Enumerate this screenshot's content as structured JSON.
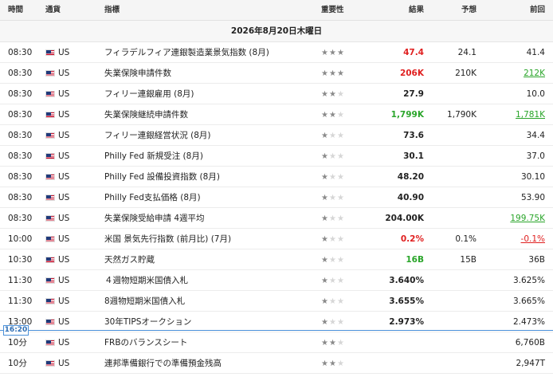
{
  "header": {
    "time": "時間",
    "currency": "通貨",
    "indicator": "指標",
    "importance": "重要性",
    "actual": "結果",
    "forecast": "予想",
    "previous": "前回"
  },
  "date_label": "2026年8月20日木曜日",
  "now_label": "16:20",
  "colors": {
    "negative": "#e02020",
    "positive": "#2aa52a",
    "now_line": "#4a90d9"
  },
  "rows": [
    {
      "time": "08:30",
      "currency": "US",
      "name": "フィラデルフィア連銀製造業景気指数 (8月)",
      "importance": 3,
      "actual": "47.4",
      "actual_color": "red",
      "forecast": "24.1",
      "previous": "41.4",
      "previous_style": ""
    },
    {
      "time": "08:30",
      "currency": "US",
      "name": "失業保険申請件数",
      "importance": 3,
      "actual": "206K",
      "actual_color": "red",
      "forecast": "210K",
      "previous": "212K",
      "previous_style": "link-green"
    },
    {
      "time": "08:30",
      "currency": "US",
      "name": "フィリー連銀雇用 (8月)",
      "importance": 2,
      "actual": "27.9",
      "actual_color": "",
      "forecast": "",
      "previous": "10.0",
      "previous_style": ""
    },
    {
      "time": "08:30",
      "currency": "US",
      "name": "失業保険継続申請件数",
      "importance": 2,
      "actual": "1,799K",
      "actual_color": "green",
      "forecast": "1,790K",
      "previous": "1,781K",
      "previous_style": "link-green"
    },
    {
      "time": "08:30",
      "currency": "US",
      "name": "フィリー連銀経営状況 (8月)",
      "importance": 1,
      "actual": "73.6",
      "actual_color": "",
      "forecast": "",
      "previous": "34.4",
      "previous_style": ""
    },
    {
      "time": "08:30",
      "currency": "US",
      "name": "Philly Fed 新規受注 (8月)",
      "importance": 1,
      "actual": "30.1",
      "actual_color": "",
      "forecast": "",
      "previous": "37.0",
      "previous_style": ""
    },
    {
      "time": "08:30",
      "currency": "US",
      "name": "Philly Fed 設備投資指数 (8月)",
      "importance": 1,
      "actual": "48.20",
      "actual_color": "",
      "forecast": "",
      "previous": "30.10",
      "previous_style": ""
    },
    {
      "time": "08:30",
      "currency": "US",
      "name": "Philly Fed支払価格 (8月)",
      "importance": 1,
      "actual": "40.90",
      "actual_color": "",
      "forecast": "",
      "previous": "53.90",
      "previous_style": ""
    },
    {
      "time": "08:30",
      "currency": "US",
      "name": "失業保険受給申請 4週平均",
      "importance": 1,
      "actual": "204.00K",
      "actual_color": "",
      "forecast": "",
      "previous": "199.75K",
      "previous_style": "link-green"
    },
    {
      "time": "10:00",
      "currency": "US",
      "name": "米国 景気先行指数 (前月比) (7月)",
      "importance": 1,
      "actual": "0.2%",
      "actual_color": "red",
      "forecast": "0.1%",
      "previous": "-0.1%",
      "previous_style": "link-red"
    },
    {
      "time": "10:30",
      "currency": "US",
      "name": "天然ガス貯蔵",
      "importance": 1,
      "actual": "16B",
      "actual_color": "green",
      "forecast": "15B",
      "previous": "36B",
      "previous_style": ""
    },
    {
      "time": "11:30",
      "currency": "US",
      "name": "４週物短期米国債入札",
      "importance": 1,
      "actual": "3.640%",
      "actual_color": "",
      "forecast": "",
      "previous": "3.625%",
      "previous_style": ""
    },
    {
      "time": "11:30",
      "currency": "US",
      "name": "8週物短期米国債入札",
      "importance": 1,
      "actual": "3.655%",
      "actual_color": "",
      "forecast": "",
      "previous": "3.665%",
      "previous_style": ""
    },
    {
      "time": "13:00",
      "currency": "US",
      "name": "30年TIPSオークション",
      "importance": 1,
      "actual": "2.973%",
      "actual_color": "",
      "forecast": "",
      "previous": "2.473%",
      "previous_style": ""
    },
    {
      "time": "10分",
      "currency": "US",
      "name": "FRBのバランスシート",
      "importance": 2,
      "actual": "",
      "actual_color": "",
      "forecast": "",
      "previous": "6,760B",
      "previous_style": ""
    },
    {
      "time": "10分",
      "currency": "US",
      "name": "連邦準備銀行での準備預金残高",
      "importance": 2,
      "actual": "",
      "actual_color": "",
      "forecast": "",
      "previous": "2,947T",
      "previous_style": ""
    }
  ]
}
